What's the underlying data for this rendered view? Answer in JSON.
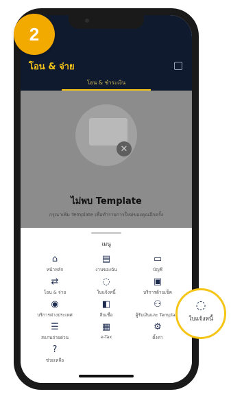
{
  "step_badge": "2",
  "header": {
    "title": "โอน & จ่าย",
    "subtab": "โอน & ชำระเงิน"
  },
  "empty_state": {
    "title": "ไม่พบ Template",
    "description": "กรุณาเพิ่ม Template เพื่อทำรายการใหม่ของคุณอีกครั้ง"
  },
  "menu": {
    "title": "เมนู",
    "items": [
      {
        "label": "หน้าหลัก",
        "icon": "home-icon"
      },
      {
        "label": "งานของฉัน",
        "icon": "task-icon"
      },
      {
        "label": "บัญชี",
        "icon": "account-icon"
      },
      {
        "label": "โอน & จ่าย",
        "icon": "transfer-icon"
      },
      {
        "label": "ใบแจ้งหนี้",
        "icon": "bill-icon"
      },
      {
        "label": "บริการด้านเช็ค",
        "icon": "cheque-icon"
      },
      {
        "label": "บริการต่างประเทศ",
        "icon": "globe-icon"
      },
      {
        "label": "สินเชื่อ",
        "icon": "loan-icon"
      },
      {
        "label": "ผู้รับเงินและ Template",
        "icon": "payee-icon"
      },
      {
        "label": "สแกนจ่ายด่วน",
        "icon": "scan-icon"
      },
      {
        "label": "e-Tax",
        "icon": "etax-icon"
      },
      {
        "label": "ตั้งค่า",
        "icon": "settings-icon"
      },
      {
        "label": "ช่วยเหลือ",
        "icon": "help-icon"
      }
    ]
  },
  "callout": {
    "label": "ใบแจ้งหนี้",
    "icon": "bill-icon"
  },
  "colors": {
    "badge": "#f2a900",
    "header_bg": "#0f1a2e",
    "accent": "#f5c518",
    "icon": "#1d2b4f"
  }
}
